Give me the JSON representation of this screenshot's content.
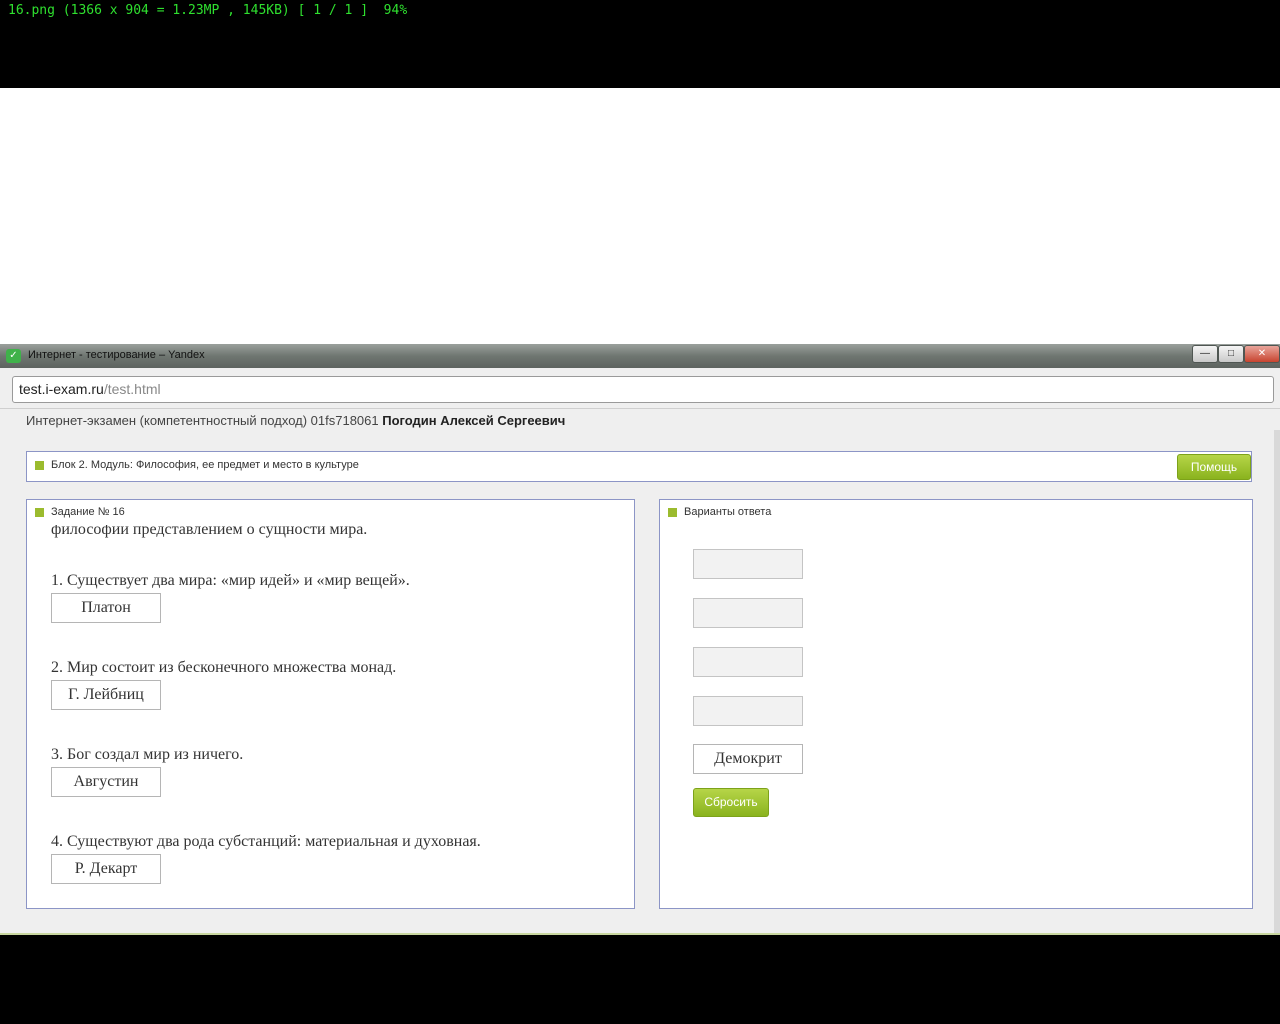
{
  "viewer": {
    "status": "16.png (1366 x 904 = 1.23MP , 145KB) [ 1 / 1 ]  94%"
  },
  "window": {
    "title": "Интернет - тестирование – Yandex",
    "buttons": {
      "minimize": "—",
      "maximize": "□",
      "close": "✕"
    }
  },
  "address": {
    "host": "test.i-exam.ru",
    "path": "/test.html"
  },
  "header": {
    "prefix": "Интернет-экзамен (компетентностный подход) 01fs718061",
    "name": "Погодин Алексей Сергеевич"
  },
  "block": {
    "title": "Блок 2. Модуль: Философия, ее предмет и место в культуре",
    "help": "Помощь"
  },
  "task": {
    "label": "Задание № 16",
    "intro": "философии представлением о сущности мира.",
    "items": [
      {
        "text": "1. Существует два мира: «мир идей» и «мир вещей».",
        "answer": "Платон"
      },
      {
        "text": "2. Мир состоит из бесконечного множества монад.",
        "answer": "Г. Лейбниц"
      },
      {
        "text": "3. Бог создал мир из ничего.",
        "answer": "Августин"
      },
      {
        "text": "4. Существуют два рода субстанций: материальная и духовная.",
        "answer": "Р. Декарт"
      }
    ]
  },
  "answers": {
    "label": "Варианты ответа",
    "slots": [
      "",
      "",
      "",
      "",
      "Демокрит"
    ],
    "reset": "Сбросить"
  },
  "colors": {
    "accent": "#9bbb2e",
    "panel_border": "#8c95c6"
  }
}
